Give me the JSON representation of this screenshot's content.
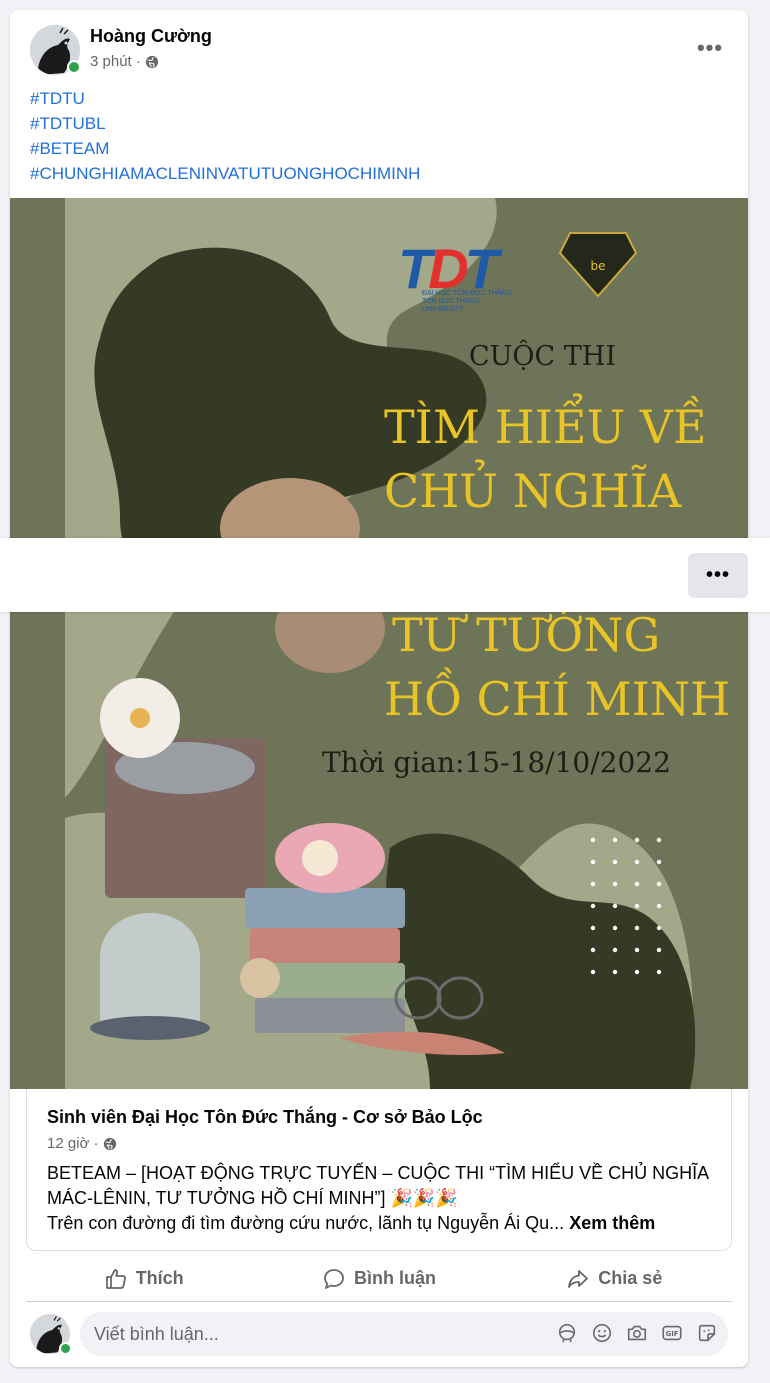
{
  "post": {
    "author": "Hoàng Cường",
    "time": "3 phút ·",
    "more_label": "•••",
    "hashtags": [
      "#TDTU",
      "#TDTUBL",
      "#BETEAM",
      "#CHUNGHIAMACLENINVATUTUONGHOCHIMINH"
    ]
  },
  "image": {
    "contest_label": "CUỘC THI",
    "title_lines": [
      "TÌM HIỂU VỀ",
      "CHỦ NGHĨA",
      "TƯ TƯỞNG",
      "HỒ CHÍ MINH"
    ],
    "time_text": "Thời gian:15-18/10/2022",
    "logo_text": "TDT",
    "logo_subtext": "ĐẠI HỌC TÔN ĐỨC THẮNG TON DUC THANG UNIVERSITY",
    "partner_logo_text": "be",
    "colors": {
      "background": "#6e7458",
      "dark_shape": "#353a24",
      "light_shape": "#a3a88a",
      "title": "#e8c427"
    }
  },
  "shared": {
    "page_name": "Sinh viên Đại Học Tôn Đức Thắng - Cơ sở Bảo Lộc",
    "time": "12 giờ ·",
    "text_line1": "BETEAM – [HOẠT ĐỘNG TRỰC TUYẾN – CUỘC THI “TÌM HIỂU VỀ CHỦ NGHĨA MÁC-LÊNIN, TƯ TƯỞNG HỒ CHÍ MINH”] 🎉🎉🎉",
    "text_line2": "Trên con đường đi tìm đường cứu nước, lãnh tụ Nguyễn Ái Qu... ",
    "see_more": "Xem thêm"
  },
  "actions": {
    "like": "Thích",
    "comment": "Bình luận",
    "share": "Chia sẻ"
  },
  "comment_box": {
    "placeholder": "Viết bình luận..."
  },
  "overlay": {
    "more_label": "•••"
  },
  "icons": {
    "like": "thumbs-up-icon",
    "comment": "speech-bubble-icon",
    "share": "share-arrow-icon",
    "privacy": "globe-icon",
    "tools": [
      "avatar-sticker-icon",
      "emoji-icon",
      "camera-icon",
      "gif-icon",
      "sticker-icon"
    ]
  }
}
